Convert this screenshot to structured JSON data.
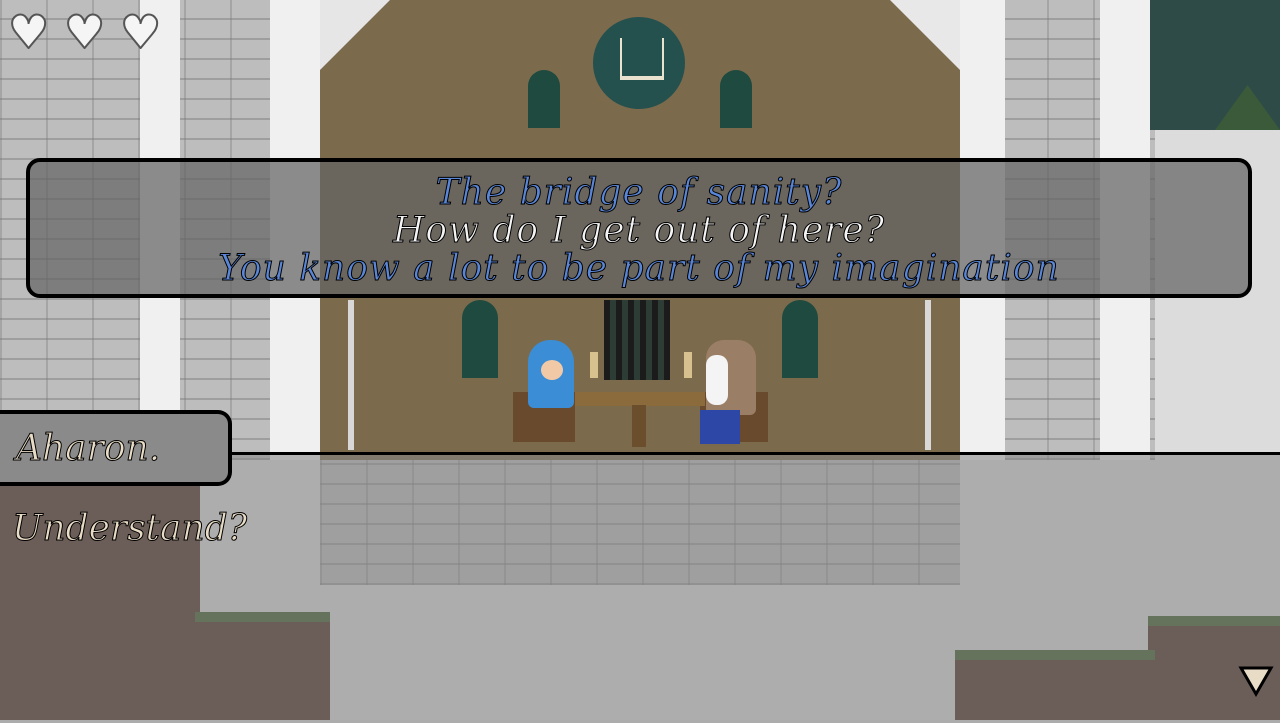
{
  "hud": {
    "hearts": [
      {
        "icon": "heart-icon",
        "glyph": "♥"
      },
      {
        "icon": "heart-icon",
        "glyph": "♥"
      },
      {
        "icon": "heart-icon",
        "glyph": "♥"
      }
    ],
    "heart_count": 3
  },
  "dialog": {
    "lines": [
      {
        "text": "The bridge of sanity?",
        "color": "#5a86d8"
      },
      {
        "text": "How do I get out of here?",
        "color": "#f4f4f4"
      },
      {
        "text": "You know a lot to be part of my imagination",
        "color": "#5a86d8"
      }
    ]
  },
  "speaker": {
    "name": "Aharon."
  },
  "response": {
    "text": "Understand?"
  },
  "advance": {
    "icon": "triangle-down-icon"
  },
  "colors": {
    "highlight_text": "#5a86d8",
    "plain_text": "#f4f4f4",
    "name_text": "#e9dcc6"
  }
}
